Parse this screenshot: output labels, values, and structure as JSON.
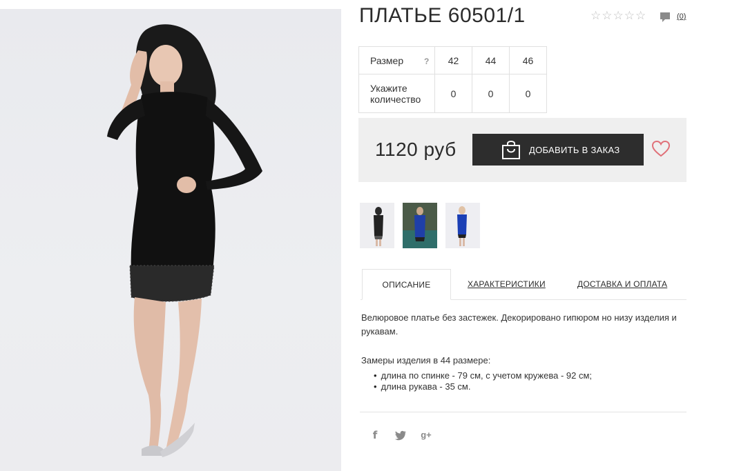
{
  "product": {
    "title": "ПЛАТЬЕ 60501/1",
    "rating_stars": 5,
    "comment_count": "(0)",
    "price": "1120 руб",
    "add_button_label": "ДОБАВИТЬ В ЗАКАЗ"
  },
  "size_table": {
    "size_label": "Размер",
    "help": "?",
    "qty_label_line1": "Укажите",
    "qty_label_line2": "количество",
    "sizes": [
      "42",
      "44",
      "46"
    ],
    "quantities": [
      "0",
      "0",
      "0"
    ]
  },
  "tabs": [
    {
      "label": "ОПИСАНИЕ",
      "active": true
    },
    {
      "label": "ХАРАКТЕРИСТИКИ",
      "active": false
    },
    {
      "label": "ДОСТАВКА И ОПЛАТА",
      "active": false
    }
  ],
  "description": {
    "text": "Велюровое платье без застежек. Декорировано гипюром но низу изделия и рукавам.",
    "measure_title": "Замеры изделия в 44 размере:",
    "measures": [
      "длина по спинке - 79 см, с учетом кружева - 92 см;",
      "длина рукава - 35 см."
    ]
  },
  "social": {
    "facebook": "f",
    "twitter": "t",
    "googleplus": "g+"
  },
  "colors": {
    "button_bg": "#2d2d2d",
    "heart": "#e07078",
    "price_block_bg": "#efefef",
    "star_empty": "#bdbdbd"
  }
}
